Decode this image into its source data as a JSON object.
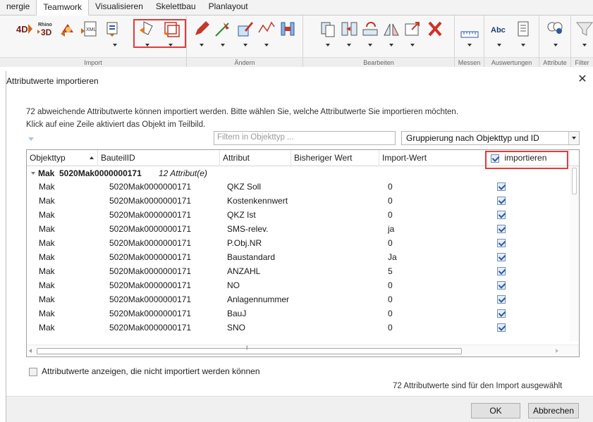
{
  "ribbon": {
    "tabs": [
      "nergie",
      "Teamwork",
      "Visualisieren",
      "Skelettbau",
      "Planlayout"
    ],
    "active_tab": 1,
    "groups": [
      "Import",
      "Ändern",
      "Bearbeiten",
      "Messen",
      "Auswertungen",
      "Attribute",
      "Filter"
    ],
    "icons": {
      "4d": "4D",
      "rhino_top": "Rhino",
      "rhino_bottom": "3D",
      "xml": "XML",
      "abc": "Abc"
    }
  },
  "dialog": {
    "title": "Attributwerte importieren",
    "close_glyph": "✕",
    "info_line1": "72 abweichende Attributwerte können importiert werden. Bitte wählen Sie, welche Attributwerte Sie importieren möchten.",
    "info_line2": "Klick auf eine Zeile aktiviert das Objekt im Teilbild.",
    "filter_placeholder": "Filtern in Objekttyp ...",
    "grouping_value": "Gruppierung nach Objekttyp und ID",
    "columns": {
      "objekttyp": "Objekttyp",
      "bauteilid": "BauteilID",
      "attribut": "Attribut",
      "bisheriger": "Bisheriger Wert",
      "import_wert": "Import-Wert",
      "importieren": "importieren"
    },
    "group": {
      "name": "Mak",
      "id": "5020Mak0000000171",
      "count": "12 Attribut(e)"
    },
    "rows": [
      {
        "typ": "Mak",
        "id": "5020Mak0000000171",
        "attr": "QKZ Soll",
        "prev": "",
        "imp": "0",
        "checked": true
      },
      {
        "typ": "Mak",
        "id": "5020Mak0000000171",
        "attr": "Kostenkennwert",
        "prev": "",
        "imp": "0",
        "checked": true
      },
      {
        "typ": "Mak",
        "id": "5020Mak0000000171",
        "attr": "QKZ Ist",
        "prev": "",
        "imp": "0",
        "checked": true
      },
      {
        "typ": "Mak",
        "id": "5020Mak0000000171",
        "attr": "SMS-relev.",
        "prev": "",
        "imp": "ja",
        "checked": true
      },
      {
        "typ": "Mak",
        "id": "5020Mak0000000171",
        "attr": "P.Obj.NR",
        "prev": "",
        "imp": "0",
        "checked": true
      },
      {
        "typ": "Mak",
        "id": "5020Mak0000000171",
        "attr": "Baustandard",
        "prev": "",
        "imp": "Ja",
        "checked": true
      },
      {
        "typ": "Mak",
        "id": "5020Mak0000000171",
        "attr": "ANZAHL",
        "prev": "",
        "imp": "5",
        "checked": true
      },
      {
        "typ": "Mak",
        "id": "5020Mak0000000171",
        "attr": "NO",
        "prev": "",
        "imp": "0",
        "checked": true
      },
      {
        "typ": "Mak",
        "id": "5020Mak0000000171",
        "attr": "Anlagennummer",
        "prev": "",
        "imp": "0",
        "checked": true
      },
      {
        "typ": "Mak",
        "id": "5020Mak0000000171",
        "attr": "BauJ",
        "prev": "",
        "imp": "0",
        "checked": true
      },
      {
        "typ": "Mak",
        "id": "5020Mak0000000171",
        "attr": "SNO",
        "prev": "",
        "imp": "0",
        "checked": true
      }
    ],
    "show_non_importable_label": "Attributwerte anzeigen, die nicht importiert werden können",
    "selected_count_text": "72 Attributwerte sind für den Import ausgewählt",
    "ok_label": "OK",
    "cancel_label": "Abbrechen"
  },
  "colors": {
    "highlight_red": "#e23a3a",
    "checkbox_blue": "#2b5aa0",
    "ribbon_bg": "#f7f7f7"
  }
}
